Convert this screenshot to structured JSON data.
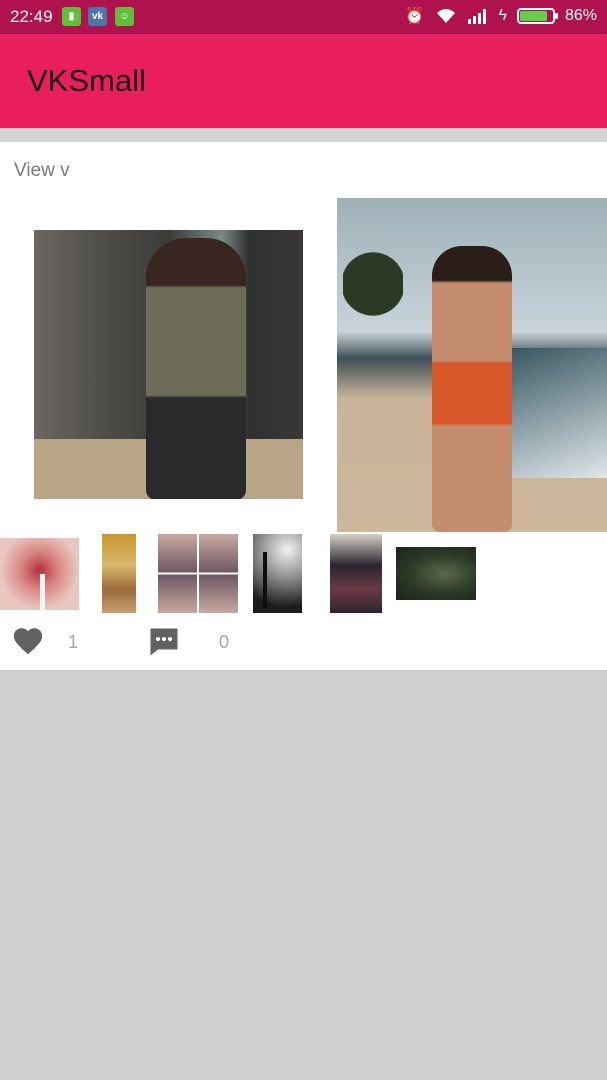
{
  "status_bar": {
    "time": "22:49",
    "battery_percent": "86%",
    "battery_level": 0.86,
    "notification_icons": [
      "sim-icon",
      "vk-icon",
      "android-icon"
    ],
    "system_icons": [
      "alarm-icon",
      "wifi-icon",
      "signal-icon",
      "charging-icon",
      "battery-icon"
    ]
  },
  "app_bar": {
    "title": "VKSmall",
    "color": "#e91e5f"
  },
  "post": {
    "view_label": "View v",
    "photos": [
      "large-photo-1",
      "large-photo-2"
    ],
    "thumbnails": [
      "thumbnail-1",
      "thumbnail-2",
      "thumbnail-3",
      "thumbnail-4",
      "thumbnail-5",
      "thumbnail-6"
    ],
    "likes": "1",
    "comments": "0",
    "like_icon": "heart-icon",
    "comment_icon": "comment-icon"
  }
}
